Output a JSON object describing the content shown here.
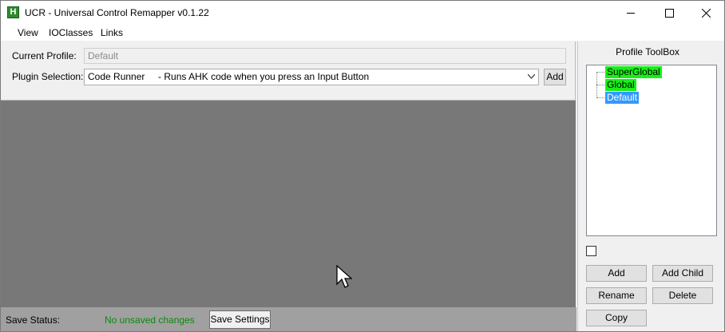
{
  "window": {
    "title": "UCR - Universal Control Remapper v0.1.22",
    "app_icon_letter": "H"
  },
  "menu": {
    "items": [
      {
        "label": "View"
      },
      {
        "label": "IOClasses"
      },
      {
        "label": "Links"
      }
    ]
  },
  "profile": {
    "current_label": "Current Profile:",
    "current_value": "Default",
    "plugin_label": "Plugin Selection:",
    "plugin_value": "Code Runner     - Runs AHK code when you press an Input Button",
    "add_label": "Add"
  },
  "status": {
    "label": "Save Status:",
    "value": "No unsaved changes",
    "value_color": "#0a8a0a",
    "save_button": "Save Settings"
  },
  "toolbox": {
    "title": "Profile ToolBox",
    "tree": [
      {
        "label": "SuperGlobal",
        "color": "#17f017"
      },
      {
        "label": "Global",
        "color": "#17f017"
      },
      {
        "label": "Default",
        "color": "#3399ff",
        "selected": true
      }
    ],
    "buttons": {
      "add": "Add",
      "add_child": "Add Child",
      "rename": "Rename",
      "delete": "Delete",
      "copy": "Copy"
    }
  },
  "colors": {
    "main_area": "#787878",
    "status_bar": "#a0a0a0"
  }
}
